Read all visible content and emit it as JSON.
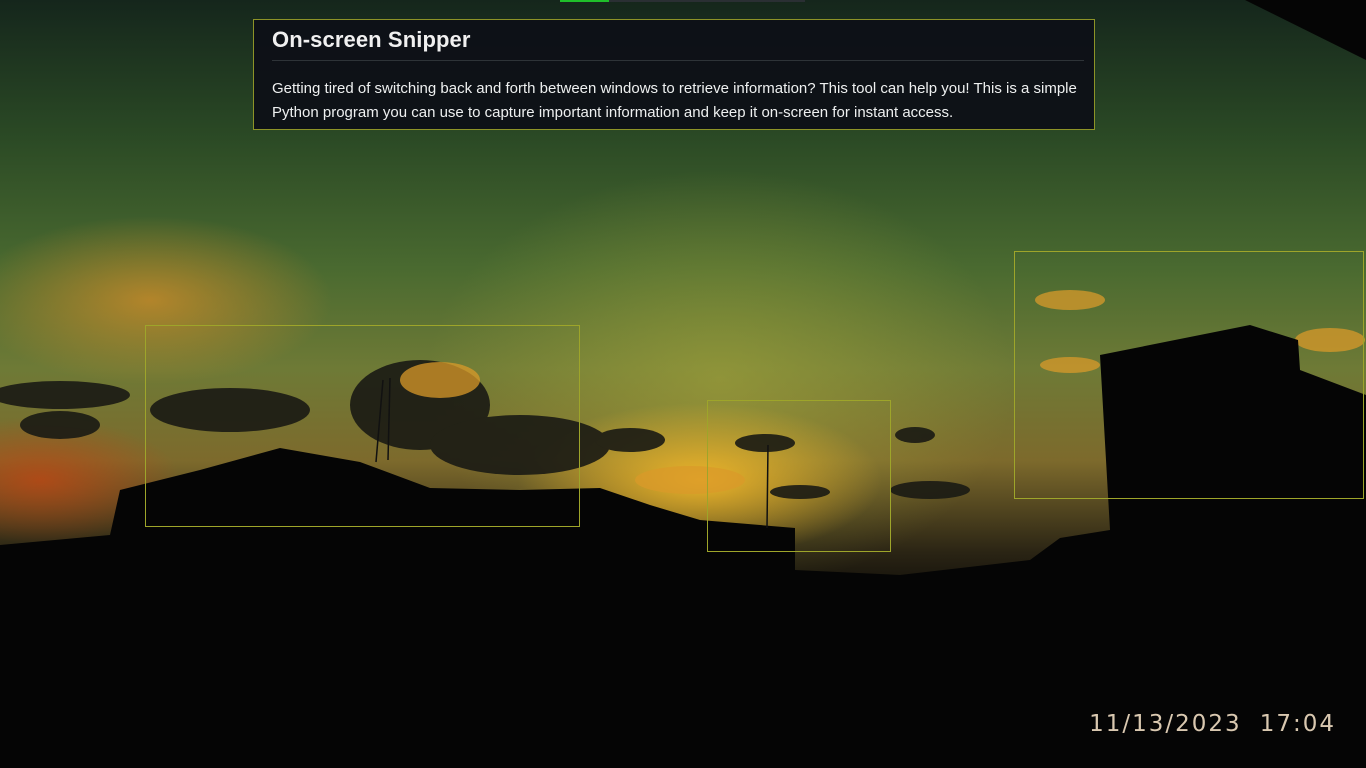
{
  "info_panel": {
    "title": "On-screen Snipper",
    "body": "Getting tired of switching back and forth between windows to retrieve information? This tool can help you! This is a simple Python program you can use to capture important information and keep it on-screen for instant access."
  },
  "progress_indicator": {
    "value_fraction": 0.2
  },
  "clock": {
    "date": "11/13/2023",
    "time": "17:04"
  },
  "snip_regions": [
    "region-1",
    "region-2",
    "region-3"
  ],
  "colors": {
    "panel_bg": "#0d1117",
    "panel_border": "#8d9327",
    "snip_border": "#9ea52a",
    "progress_fill": "#1fbf2a",
    "clock_text": "#d9c8b0"
  }
}
